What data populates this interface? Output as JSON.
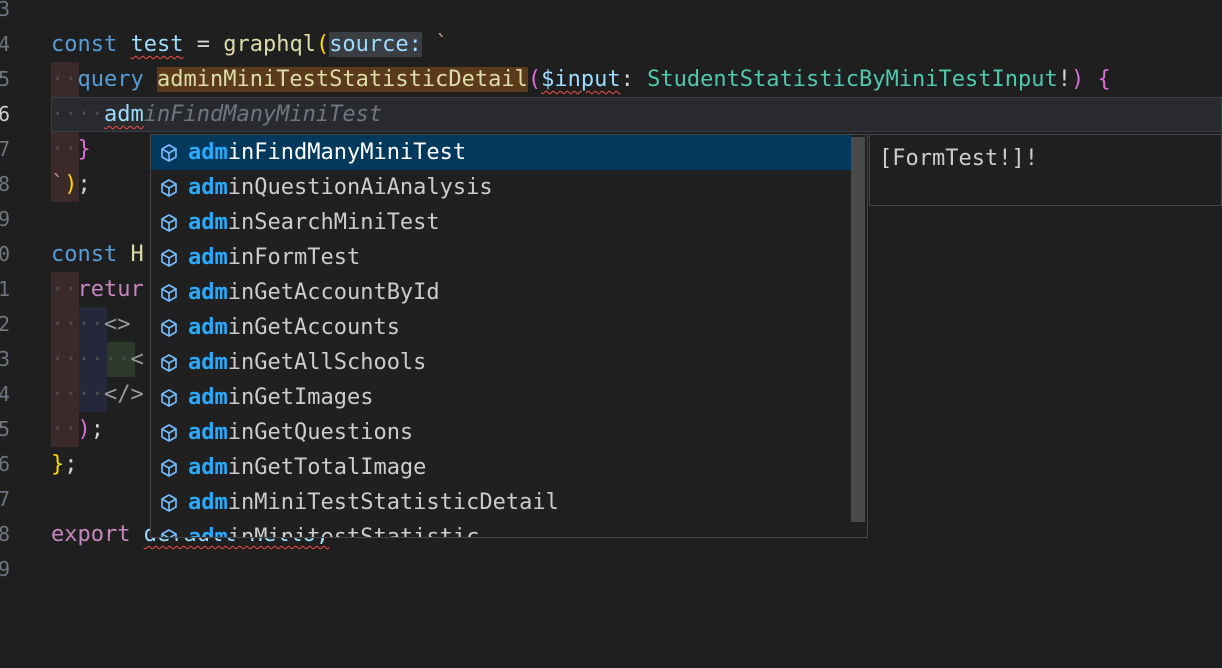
{
  "gutter_numbers": [
    "3",
    "4",
    "5",
    "6",
    "7",
    "8",
    "9",
    "0",
    "1",
    "2",
    "3",
    "4",
    "5",
    "6",
    "7",
    "8",
    "9"
  ],
  "code": {
    "l1": {
      "const": "const",
      "name": "test",
      "eq": "=",
      "fn": "graphql",
      "open": "(",
      "param": "source:",
      "tick": "`"
    },
    "l2": {
      "indent": "··",
      "query": "query",
      "opname": "adminMiniTestStatisticDetail",
      "open": "(",
      "var": "$input",
      "colon": ":",
      "type": "StudentStatisticByMiniTestInput",
      "bang": "!",
      "close": ")",
      "brace": "{"
    },
    "l3": {
      "indent": "····",
      "typed": "adm",
      "ghost": "inFindManyMiniTest"
    },
    "l4": {
      "indent": "··",
      "brace": "}"
    },
    "l5": {
      "tick": "`",
      "close": ")",
      "semi": ";"
    },
    "l7": {
      "const": "const",
      "partial": "H"
    },
    "l8": {
      "indent": "··",
      "partial": "retur"
    },
    "l9": {
      "indent": "····",
      "tag": "<>"
    },
    "l10": {
      "indent": "······",
      "tag": "<"
    },
    "l11": {
      "indent": "····",
      "tag": "</>"
    },
    "l12": {
      "indent": "··",
      "close": ")",
      "semi": ";"
    },
    "l13": {
      "close": "}",
      "semi": ";"
    },
    "l15": {
      "export": "export",
      "rest": "default Hello;"
    }
  },
  "suggest": {
    "typed_prefix": "adm",
    "items": [
      {
        "rest": "inFindManyMiniTest",
        "selected": true
      },
      {
        "rest": "inQuestionAiAnalysis",
        "selected": false
      },
      {
        "rest": "inSearchMiniTest",
        "selected": false
      },
      {
        "rest": "inFormTest",
        "selected": false
      },
      {
        "rest": "inGetAccountById",
        "selected": false
      },
      {
        "rest": "inGetAccounts",
        "selected": false
      },
      {
        "rest": "inGetAllSchools",
        "selected": false
      },
      {
        "rest": "inGetImages",
        "selected": false
      },
      {
        "rest": "inGetQuestions",
        "selected": false
      },
      {
        "rest": "inGetTotalImage",
        "selected": false
      },
      {
        "rest": "inMiniTestStatisticDetail",
        "selected": false
      },
      {
        "rest": "inMinitestStatistic",
        "selected": false
      }
    ],
    "item_icon": "symbol-field-cube-icon",
    "details": "[FormTest!]!"
  },
  "colors": {
    "editor_bg": "#1f1f1f",
    "selected_item_bg": "#04395e",
    "match_highlight": "#2aaaff",
    "keyword": "#569cd6",
    "type": "#4ec9b0",
    "function": "#dcdcaa"
  }
}
